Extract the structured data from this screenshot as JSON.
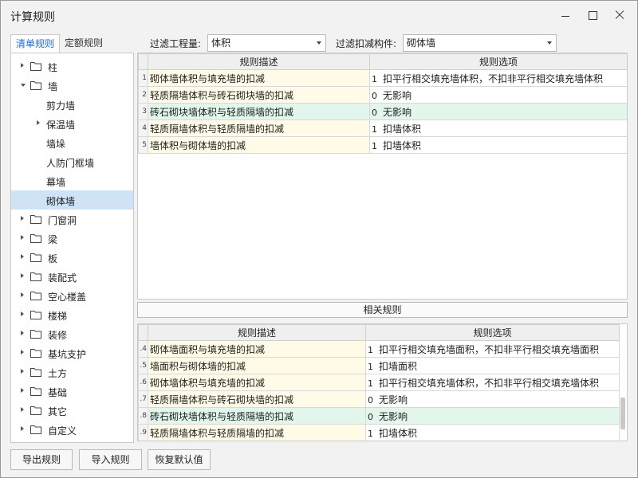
{
  "window": {
    "title": "计算规则"
  },
  "tabs": [
    {
      "label": "清单规则",
      "active": true
    },
    {
      "label": "定额规则",
      "active": false
    }
  ],
  "filters": {
    "quantity_label": "过滤工程量:",
    "quantity_value": "体积",
    "component_label": "过滤扣减构件:",
    "component_value": "砌体墙"
  },
  "tree": [
    {
      "label": "柱",
      "level": 0,
      "state": "collapsed",
      "folder": true
    },
    {
      "label": "墙",
      "level": 0,
      "state": "expanded",
      "folder": true
    },
    {
      "label": "剪力墙",
      "level": 1,
      "state": "none",
      "folder": false
    },
    {
      "label": "保温墙",
      "level": 1,
      "state": "collapsed",
      "folder": false
    },
    {
      "label": "墙垛",
      "level": 1,
      "state": "none",
      "folder": false
    },
    {
      "label": "人防门框墙",
      "level": 1,
      "state": "none",
      "folder": false
    },
    {
      "label": "幕墙",
      "level": 1,
      "state": "none",
      "folder": false
    },
    {
      "label": "砌体墙",
      "level": 1,
      "state": "none",
      "folder": false,
      "selected": true
    },
    {
      "label": "门窗洞",
      "level": 0,
      "state": "collapsed",
      "folder": true
    },
    {
      "label": "梁",
      "level": 0,
      "state": "collapsed",
      "folder": true
    },
    {
      "label": "板",
      "level": 0,
      "state": "collapsed",
      "folder": true
    },
    {
      "label": "装配式",
      "level": 0,
      "state": "collapsed",
      "folder": true
    },
    {
      "label": "空心楼盖",
      "level": 0,
      "state": "collapsed",
      "folder": true
    },
    {
      "label": "楼梯",
      "level": 0,
      "state": "collapsed",
      "folder": true
    },
    {
      "label": "装修",
      "level": 0,
      "state": "collapsed",
      "folder": true
    },
    {
      "label": "基坑支护",
      "level": 0,
      "state": "collapsed",
      "folder": true
    },
    {
      "label": "土方",
      "level": 0,
      "state": "collapsed",
      "folder": true
    },
    {
      "label": "基础",
      "level": 0,
      "state": "collapsed",
      "folder": true
    },
    {
      "label": "其它",
      "level": 0,
      "state": "collapsed",
      "folder": true
    },
    {
      "label": "自定义",
      "level": 0,
      "state": "collapsed",
      "folder": true
    }
  ],
  "main_grid": {
    "headers": [
      "规则描述",
      "规则选项"
    ],
    "rows": [
      {
        "num": "1",
        "desc": "砌体墙体积与填充墙的扣减",
        "opt_value": "1",
        "opt_text": "扣平行相交填充墙体积，不扣非平行相交填充墙体积",
        "highlight": false
      },
      {
        "num": "2",
        "desc": "轻质隔墙体积与砖石砌块墙的扣减",
        "opt_value": "0",
        "opt_text": "无影响",
        "highlight": false
      },
      {
        "num": "3",
        "desc": "砖石砌块墙体积与轻质隔墙的扣减",
        "opt_value": "0",
        "opt_text": "无影响",
        "highlight": true
      },
      {
        "num": "4",
        "desc": "轻质隔墙体积与轻质隔墙的扣减",
        "opt_value": "1",
        "opt_text": "扣墙体积",
        "highlight": false
      },
      {
        "num": "5",
        "desc": "墙体积与砌体墙的扣减",
        "opt_value": "1",
        "opt_text": "扣墙体积",
        "highlight": false
      }
    ]
  },
  "related_label": "相关规则",
  "related_grid": {
    "headers": [
      "规则描述",
      "规则选项"
    ],
    "rows": [
      {
        "num": ".4",
        "desc": "砌体墙面积与填充墙的扣减",
        "opt_value": "1",
        "opt_text": "扣平行相交填充墙面积，不扣非平行相交填充墙面积",
        "highlight": false
      },
      {
        "num": ".5",
        "desc": "墙面积与砌体墙的扣减",
        "opt_value": "1",
        "opt_text": "扣墙面积",
        "highlight": false
      },
      {
        "num": ".6",
        "desc": "砌体墙体积与填充墙的扣减",
        "opt_value": "1",
        "opt_text": "扣平行相交填充墙体积，不扣非平行相交填充墙体积",
        "highlight": false
      },
      {
        "num": ".7",
        "desc": "轻质隔墙体积与砖石砌块墙的扣减",
        "opt_value": "0",
        "opt_text": "无影响",
        "highlight": false
      },
      {
        "num": ".8",
        "desc": "砖石砌块墙体积与轻质隔墙的扣减",
        "opt_value": "0",
        "opt_text": "无影响",
        "highlight": true
      },
      {
        "num": ".9",
        "desc": "轻质隔墙体积与轻质隔墙的扣减",
        "opt_value": "1",
        "opt_text": "扣墙体积",
        "highlight": false
      }
    ]
  },
  "buttons": {
    "export": "导出规则",
    "import": "导入规则",
    "restore": "恢复默认值"
  },
  "colors": {
    "accent": "#1a6bd3",
    "selected_bg": "#cfe3f7",
    "desc_bg": "#fffbe6",
    "highlight_bg": "#e2f6ec"
  }
}
